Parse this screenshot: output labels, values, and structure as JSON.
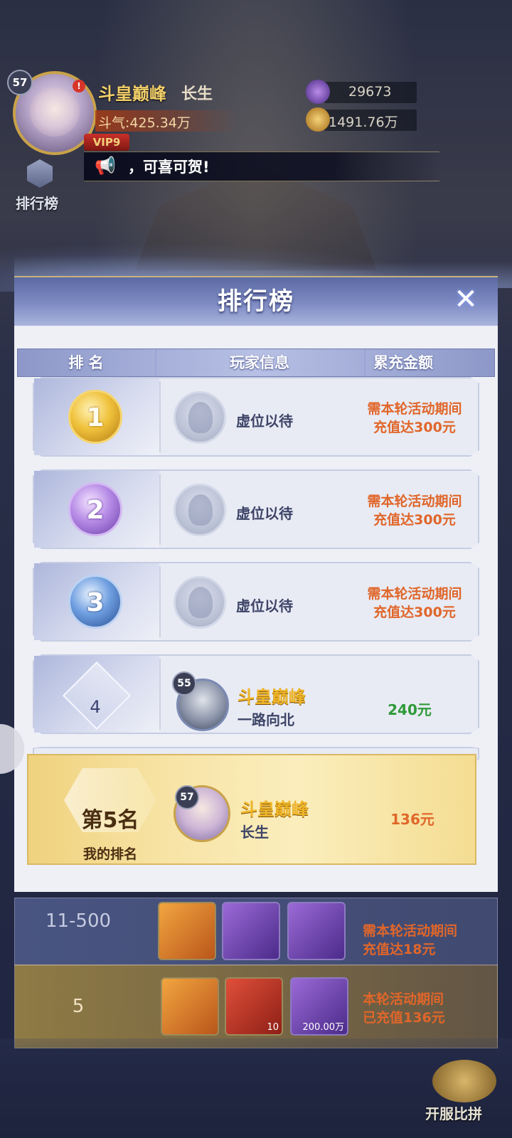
{
  "header": {
    "level": "57",
    "title": "斗皇巅峰",
    "name": "长生",
    "power": "斗气:425.34万",
    "vip": "VIP9",
    "red_dot": "!",
    "currency1": "29673",
    "currency2": "1491.76万",
    "notice": "，可喜可贺!",
    "rank_button": "排行榜"
  },
  "modal": {
    "title": "排行榜",
    "close": "✕",
    "columns": [
      "排 名",
      "玩家信息",
      "累充金额"
    ],
    "rows": [
      {
        "rank": "1",
        "text": "虚位以待",
        "req_line1": "需本轮活动期间",
        "req_line2": "充值达300元"
      },
      {
        "rank": "2",
        "text": "虚位以待",
        "req_line1": "需本轮活动期间",
        "req_line2": "充值达300元"
      },
      {
        "rank": "3",
        "text": "虚位以待",
        "req_line1": "需本轮活动期间",
        "req_line2": "充值达300元"
      },
      {
        "rank": "4",
        "level": "55",
        "title": "斗皇巅峰",
        "name": "一路向北",
        "amount": "240元"
      }
    ],
    "my_rank": {
      "rank": "第5名",
      "label": "我的排名",
      "level": "57",
      "title": "斗皇巅峰",
      "name": "长生",
      "amount": "136元"
    }
  },
  "lower": {
    "row_a": {
      "rank": "11-500",
      "line1": "需本轮活动期间",
      "line2": "充值达18元"
    },
    "row_b": {
      "rank": "5",
      "line1": "本轮活动期间",
      "line2": "已充值136元",
      "qty1": "10",
      "qty2": "200.00万"
    },
    "side_button": "开服比拼"
  },
  "colors": {
    "accent_orange": "#e0662a",
    "amount_green": "#2f9a3a",
    "gold_title": "#f0b629"
  }
}
